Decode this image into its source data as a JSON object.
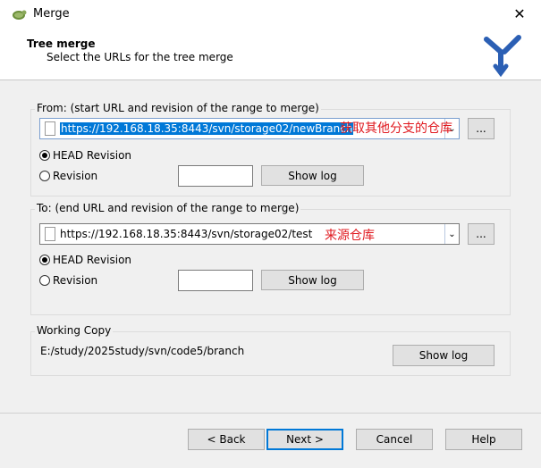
{
  "window": {
    "title": "Merge"
  },
  "header": {
    "title": "Tree merge",
    "subtitle": "Select the URLs for the tree merge"
  },
  "from": {
    "group_title": "From: (start URL and revision of the range to merge)",
    "url": "https://192.168.18.35:8443/svn/storage02/newBranch",
    "annotation": "获取其他分支的仓库",
    "browse_label": "...",
    "head_revision_label": "HEAD Revision",
    "revision_label": "Revision",
    "revision_value": "",
    "show_log_label": "Show log"
  },
  "to": {
    "group_title": "To: (end URL and revision of the range to merge)",
    "url": "https://192.168.18.35:8443/svn/storage02/test",
    "annotation": "来源仓库",
    "browse_label": "...",
    "head_revision_label": "HEAD Revision",
    "revision_label": "Revision",
    "revision_value": "",
    "show_log_label": "Show log"
  },
  "working_copy": {
    "group_title": "Working Copy",
    "path": "E:/study/2025study/svn/code5/branch",
    "show_log_label": "Show log"
  },
  "footer": {
    "back_label": "< Back",
    "next_label": "Next >",
    "cancel_label": "Cancel",
    "help_label": "Help"
  },
  "icons": {
    "app": "tortoise-icon",
    "close": "close-icon",
    "logo": "merge-branch-icon",
    "dropdown": "chevron-down-icon",
    "file": "file-icon"
  }
}
